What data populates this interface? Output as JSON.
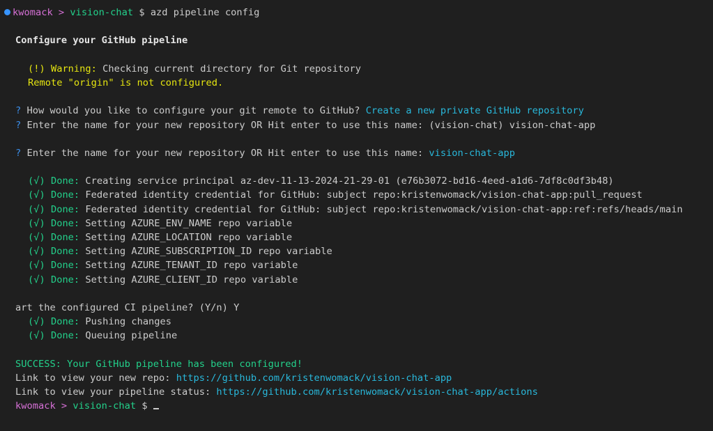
{
  "prompt": {
    "user": "kwomack",
    "sep": " > ",
    "dir": "vision-chat",
    "symbol": " $ ",
    "command": "azd pipeline config"
  },
  "header": "Configure your GitHub pipeline",
  "warning": {
    "label": "(!) Warning:",
    "text": " Checking current directory for Git repository",
    "remote": "Remote \"origin\" is not configured."
  },
  "questions": [
    {
      "mark": "?",
      "text": " How would you like to configure your git remote to GitHub? ",
      "answer": "Create a new private GitHub repository"
    },
    {
      "mark": "?",
      "text": " Enter the name for your new repository OR Hit enter to use this name: (vision-chat) vision-chat-app",
      "answer": ""
    },
    {
      "mark": "?",
      "text": " Enter the name for your new repository OR Hit enter to use this name: ",
      "answer": "vision-chat-app"
    }
  ],
  "done_label": "(√) Done:",
  "steps": [
    " Creating service principal az-dev-11-13-2024-21-29-01 (e76b3072-bd16-4eed-a1d6-7df8c0df3b48)",
    " Federated identity credential for GitHub: subject repo:kristenwomack/vision-chat-app:pull_request",
    " Federated identity credential for GitHub: subject repo:kristenwomack/vision-chat-app:ref:refs/heads/main",
    " Setting AZURE_ENV_NAME repo variable",
    " Setting AZURE_LOCATION repo variable",
    " Setting AZURE_SUBSCRIPTION_ID repo variable",
    " Setting AZURE_TENANT_ID repo variable",
    " Setting AZURE_CLIENT_ID repo variable"
  ],
  "start_prompt": "art the configured CI pipeline? (Y/n) Y",
  "push_steps": [
    " Pushing changes",
    " Queuing pipeline"
  ],
  "success": "SUCCESS: Your GitHub pipeline has been configured!",
  "repo_link": {
    "label": "Link to view your new repo: ",
    "url": "https://github.com/kristenwomack/vision-chat-app"
  },
  "status_link": {
    "label": "Link to view your pipeline status: ",
    "url": "https://github.com/kristenwomack/vision-chat-app/actions"
  },
  "colors": {
    "background": "#1f1f1f",
    "user": "#d670d6",
    "dir": "#23d18b",
    "warning": "#e5e510",
    "question": "#3b8eea",
    "answer": "#29b8db",
    "done": "#23d18b"
  }
}
